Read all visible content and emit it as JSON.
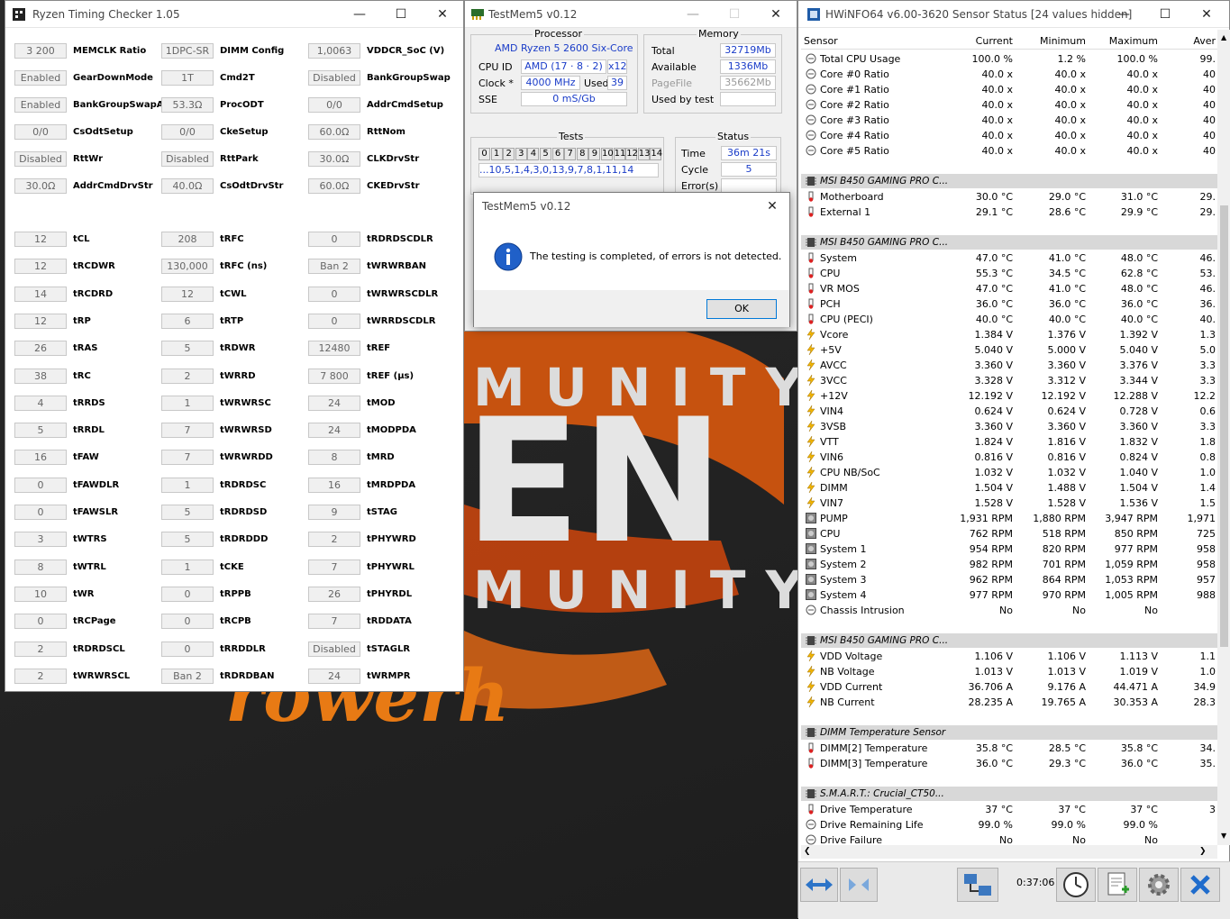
{
  "rtc": {
    "title": "Ryzen Timing Checker 1.05",
    "fields": [
      [
        [
          "3 200",
          "MEMCLK Ratio"
        ],
        [
          "Enabled",
          "GearDownMode"
        ],
        [
          "Enabled",
          "BankGroupSwapAlt"
        ],
        [
          "0/0",
          "CsOdtSetup"
        ],
        [
          "Disabled",
          "RttWr"
        ],
        [
          "30.0Ω",
          "AddrCmdDrvStr"
        ],
        null,
        [
          "12",
          "tCL"
        ],
        [
          "12",
          "tRCDWR"
        ],
        [
          "14",
          "tRCDRD"
        ],
        [
          "12",
          "tRP"
        ],
        [
          "26",
          "tRAS"
        ],
        [
          "38",
          "tRC"
        ],
        [
          "4",
          "tRRDS"
        ],
        [
          "5",
          "tRRDL"
        ],
        [
          "16",
          "tFAW"
        ],
        [
          "0",
          "tFAWDLR"
        ],
        [
          "0",
          "tFAWSLR"
        ],
        [
          "3",
          "tWTRS"
        ],
        [
          "8",
          "tWTRL"
        ],
        [
          "10",
          "tWR"
        ],
        [
          "0",
          "tRCPage"
        ],
        [
          "2",
          "tRDRDSCL"
        ],
        [
          "2",
          "tWRWRSCL"
        ]
      ],
      [
        [
          "1DPC-SR",
          "DIMM Config"
        ],
        [
          "1T",
          "Cmd2T"
        ],
        [
          "53.3Ω",
          "ProcODT"
        ],
        [
          "0/0",
          "CkeSetup"
        ],
        [
          "Disabled",
          "RttPark"
        ],
        [
          "40.0Ω",
          "CsOdtDrvStr"
        ],
        null,
        [
          "208",
          "tRFC"
        ],
        [
          "130,000",
          "tRFC (ns)"
        ],
        [
          "12",
          "tCWL"
        ],
        [
          "6",
          "tRTP"
        ],
        [
          "5",
          "tRDWR"
        ],
        [
          "2",
          "tWRRD"
        ],
        [
          "1",
          "tWRWRSC"
        ],
        [
          "7",
          "tWRWRSD"
        ],
        [
          "7",
          "tWRWRDD"
        ],
        [
          "1",
          "tRDRDSC"
        ],
        [
          "5",
          "tRDRDSD"
        ],
        [
          "5",
          "tRDRDDD"
        ],
        [
          "1",
          "tCKE"
        ],
        [
          "0",
          "tRPPB"
        ],
        [
          "0",
          "tRCPB"
        ],
        [
          "0",
          "tRRDDLR"
        ],
        [
          "Ban 2",
          "tRDRDBAN"
        ]
      ],
      [
        [
          "1,0063",
          "VDDCR_SoC (V)"
        ],
        [
          "Disabled",
          "BankGroupSwap"
        ],
        [
          "0/0",
          "AddrCmdSetup"
        ],
        [
          "60.0Ω",
          "RttNom"
        ],
        [
          "30.0Ω",
          "CLKDrvStr"
        ],
        [
          "60.0Ω",
          "CKEDrvStr"
        ],
        null,
        [
          "0",
          "tRDRDSCDLR"
        ],
        [
          "Ban 2",
          "tWRWRBAN"
        ],
        [
          "0",
          "tWRWRSCDLR"
        ],
        [
          "0",
          "tWRRDSCDLR"
        ],
        [
          "12480",
          "tREF"
        ],
        [
          "7 800",
          "tREF (µs)"
        ],
        [
          "24",
          "tMOD"
        ],
        [
          "24",
          "tMODPDA"
        ],
        [
          "8",
          "tMRD"
        ],
        [
          "16",
          "tMRDPDA"
        ],
        [
          "9",
          "tSTAG"
        ],
        [
          "2",
          "tPHYWRD"
        ],
        [
          "7",
          "tPHYWRL"
        ],
        [
          "26",
          "tPHYRDL"
        ],
        [
          "7",
          "tRDDATA"
        ],
        [
          "Disabled",
          "tSTAGLR"
        ],
        [
          "24",
          "tWRMPR"
        ]
      ]
    ]
  },
  "tm": {
    "title": "TestMem5 v0.12",
    "processor_label": "Processor",
    "cpu_name": "AMD Ryzen 5 2600 Six-Core",
    "cpu_id_label": "CPU ID",
    "cpu_id": "AMD  (17 · 8 · 2)",
    "threads": "x12",
    "clock_label": "Clock *",
    "clock": "4000 MHz",
    "used_label": "Used",
    "used": "39",
    "sse_label": "SSE",
    "sse": "0 mS/Gb",
    "memory_label": "Memory",
    "total_label": "Total",
    "total": "32719Mb",
    "avail_label": "Available",
    "avail": "1336Mb",
    "pagefile_label": "PageFile",
    "pagefile": "35662Mb",
    "usedby_label": "Used by test",
    "usedby": "",
    "tests_label": "Tests",
    "test_nums": [
      "0",
      "1",
      "2",
      "3",
      "4",
      "5",
      "6",
      "7",
      "8",
      "9",
      "10",
      "11",
      "12",
      "13",
      "14"
    ],
    "test_seq": "...10,5,1,4,3,0,13,9,7,8,1,11,14",
    "status_label": "Status",
    "time_label": "Time",
    "time": "36m 21s",
    "cycle_label": "Cycle",
    "cycle": "5",
    "errors_label": "Error(s)",
    "errors": ""
  },
  "dialog": {
    "title": "TestMem5 v0.12",
    "message": "The testing is completed, of errors is not detected.",
    "ok": "OK"
  },
  "hw": {
    "title": "HWiNFO64 v6.00-3620 Sensor Status [24 values hidden]",
    "headers": [
      "Sensor",
      "Current",
      "Minimum",
      "Maximum",
      "Aver"
    ],
    "rows": [
      [
        "c",
        "Total CPU Usage",
        "100.0 %",
        "1.2 %",
        "100.0 %",
        "99."
      ],
      [
        "c",
        "Core #0 Ratio",
        "40.0 x",
        "40.0 x",
        "40.0 x",
        "40"
      ],
      [
        "c",
        "Core #1 Ratio",
        "40.0 x",
        "40.0 x",
        "40.0 x",
        "40"
      ],
      [
        "c",
        "Core #2 Ratio",
        "40.0 x",
        "40.0 x",
        "40.0 x",
        "40"
      ],
      [
        "c",
        "Core #3 Ratio",
        "40.0 x",
        "40.0 x",
        "40.0 x",
        "40"
      ],
      [
        "c",
        "Core #4 Ratio",
        "40.0 x",
        "40.0 x",
        "40.0 x",
        "40"
      ],
      [
        "c",
        "Core #5 Ratio",
        "40.0 x",
        "40.0 x",
        "40.0 x",
        "40"
      ],
      [
        "e"
      ],
      [
        "g",
        "MSI B450 GAMING PRO C..."
      ],
      [
        "t",
        "Motherboard",
        "30.0 °C",
        "29.0 °C",
        "31.0 °C",
        "29."
      ],
      [
        "t",
        "External 1",
        "29.1 °C",
        "28.6 °C",
        "29.9 °C",
        "29."
      ],
      [
        "e"
      ],
      [
        "g",
        "MSI B450 GAMING PRO C..."
      ],
      [
        "t",
        "System",
        "47.0 °C",
        "41.0 °C",
        "48.0 °C",
        "46."
      ],
      [
        "t",
        "CPU",
        "55.3 °C",
        "34.5 °C",
        "62.8 °C",
        "53."
      ],
      [
        "t",
        "VR MOS",
        "47.0 °C",
        "41.0 °C",
        "48.0 °C",
        "46."
      ],
      [
        "t",
        "PCH",
        "36.0 °C",
        "36.0 °C",
        "36.0 °C",
        "36."
      ],
      [
        "t",
        "CPU (PECI)",
        "40.0 °C",
        "40.0 °C",
        "40.0 °C",
        "40."
      ],
      [
        "v",
        "Vcore",
        "1.384 V",
        "1.376 V",
        "1.392 V",
        "1.3"
      ],
      [
        "v",
        "+5V",
        "5.040 V",
        "5.000 V",
        "5.040 V",
        "5.0"
      ],
      [
        "v",
        "AVCC",
        "3.360 V",
        "3.360 V",
        "3.376 V",
        "3.3"
      ],
      [
        "v",
        "3VCC",
        "3.328 V",
        "3.312 V",
        "3.344 V",
        "3.3"
      ],
      [
        "v",
        "+12V",
        "12.192 V",
        "12.192 V",
        "12.288 V",
        "12.2"
      ],
      [
        "v",
        "VIN4",
        "0.624 V",
        "0.624 V",
        "0.728 V",
        "0.6"
      ],
      [
        "v",
        "3VSB",
        "3.360 V",
        "3.360 V",
        "3.360 V",
        "3.3"
      ],
      [
        "v",
        "VTT",
        "1.824 V",
        "1.816 V",
        "1.832 V",
        "1.8"
      ],
      [
        "v",
        "VIN6",
        "0.816 V",
        "0.816 V",
        "0.824 V",
        "0.8"
      ],
      [
        "v",
        "CPU NB/SoC",
        "1.032 V",
        "1.032 V",
        "1.040 V",
        "1.0"
      ],
      [
        "v",
        "DIMM",
        "1.504 V",
        "1.488 V",
        "1.504 V",
        "1.4"
      ],
      [
        "v",
        "VIN7",
        "1.528 V",
        "1.528 V",
        "1.536 V",
        "1.5"
      ],
      [
        "f",
        "PUMP",
        "1,931 RPM",
        "1,880 RPM",
        "3,947 RPM",
        "1,971"
      ],
      [
        "f",
        "CPU",
        "762 RPM",
        "518 RPM",
        "850 RPM",
        "725"
      ],
      [
        "f",
        "System 1",
        "954 RPM",
        "820 RPM",
        "977 RPM",
        "958"
      ],
      [
        "f",
        "System 2",
        "982 RPM",
        "701 RPM",
        "1,059 RPM",
        "958"
      ],
      [
        "f",
        "System 3",
        "962 RPM",
        "864 RPM",
        "1,053 RPM",
        "957"
      ],
      [
        "f",
        "System 4",
        "977 RPM",
        "970 RPM",
        "1,005 RPM",
        "988"
      ],
      [
        "c",
        "Chassis Intrusion",
        "No",
        "No",
        "No",
        ""
      ],
      [
        "e"
      ],
      [
        "g",
        "MSI B450 GAMING PRO C..."
      ],
      [
        "v",
        "VDD Voltage",
        "1.106 V",
        "1.106 V",
        "1.113 V",
        "1.1"
      ],
      [
        "v",
        "NB Voltage",
        "1.013 V",
        "1.013 V",
        "1.019 V",
        "1.0"
      ],
      [
        "v",
        "VDD Current",
        "36.706 A",
        "9.176 A",
        "44.471 A",
        "34.9"
      ],
      [
        "v",
        "NB Current",
        "28.235 A",
        "19.765 A",
        "30.353 A",
        "28.3"
      ],
      [
        "e"
      ],
      [
        "g",
        "DIMM Temperature Sensor"
      ],
      [
        "t",
        "DIMM[2] Temperature",
        "35.8 °C",
        "28.5 °C",
        "35.8 °C",
        "34."
      ],
      [
        "t",
        "DIMM[3] Temperature",
        "36.0 °C",
        "29.3 °C",
        "36.0 °C",
        "35."
      ],
      [
        "e"
      ],
      [
        "g",
        "S.M.A.R.T.: Crucial_CT50..."
      ],
      [
        "t",
        "Drive Temperature",
        "37 °C",
        "37 °C",
        "37 °C",
        "3"
      ],
      [
        "c",
        "Drive Remaining Life",
        "99.0 %",
        "99.0 %",
        "99.0 %",
        ""
      ],
      [
        "c",
        "Drive Failure",
        "No",
        "No",
        "No",
        ""
      ]
    ],
    "clock": "0:37:06"
  },
  "bg": {
    "line1": "MUNITY",
    "line2": "EN",
    "line3": "MUNITY",
    "line4": "rowerh"
  }
}
